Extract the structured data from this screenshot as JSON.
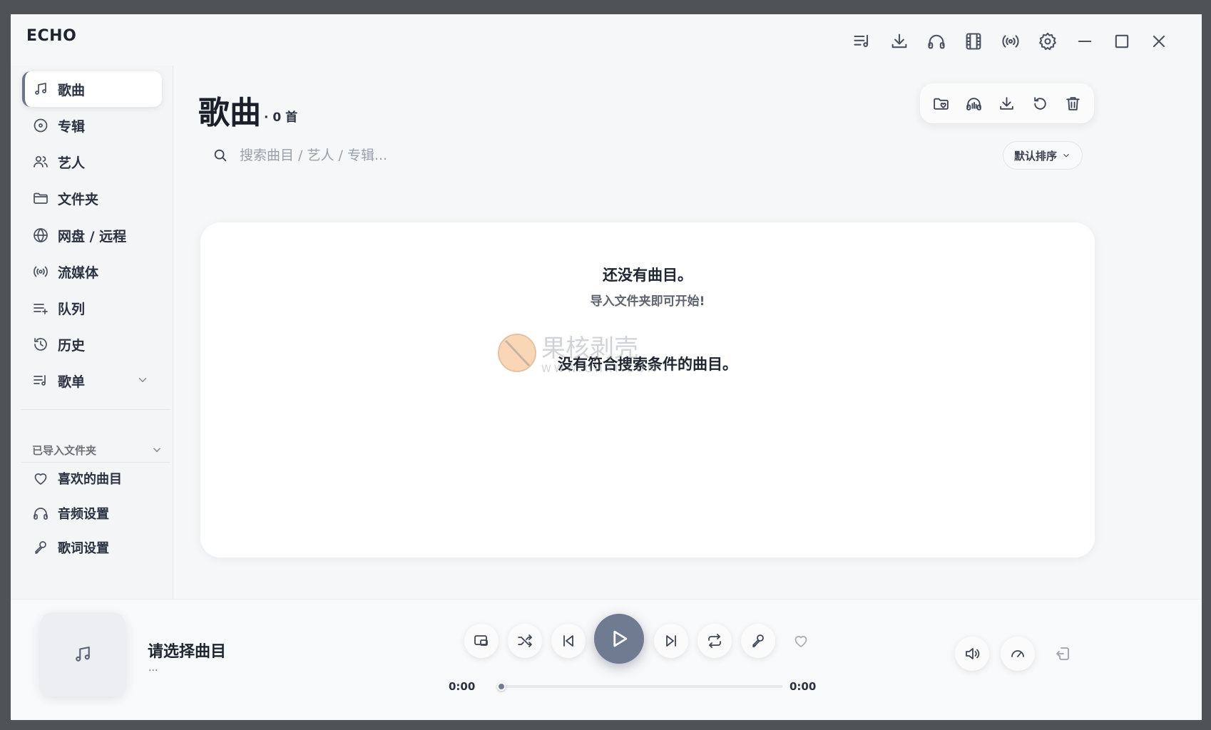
{
  "app": {
    "title": "ECHO"
  },
  "titlebar": {
    "icons": [
      "playlist-icon",
      "download-icon",
      "headphones-icon",
      "film-icon",
      "broadcast-icon",
      "gear-icon",
      "minimize-icon",
      "maximize-icon",
      "close-icon"
    ]
  },
  "sidebar": {
    "items": [
      {
        "label": "歌曲",
        "icon": "music-note-icon",
        "active": true
      },
      {
        "label": "专辑",
        "icon": "disc-icon"
      },
      {
        "label": "艺人",
        "icon": "users-icon"
      },
      {
        "label": "文件夹",
        "icon": "folder-icon"
      },
      {
        "label": "网盘 / 远程",
        "icon": "globe-icon"
      },
      {
        "label": "流媒体",
        "icon": "broadcast-icon"
      },
      {
        "label": "队列",
        "icon": "queue-icon"
      },
      {
        "label": "历史",
        "icon": "history-icon"
      },
      {
        "label": "歌单",
        "icon": "playlist-icon"
      }
    ],
    "section": {
      "label": "已导入文件夹"
    },
    "sub_items": [
      {
        "label": "喜欢的曲目",
        "icon": "heart-icon"
      },
      {
        "label": "音频设置",
        "icon": "headphones-icon"
      },
      {
        "label": "歌词设置",
        "icon": "microphone-icon"
      }
    ]
  },
  "main": {
    "title": "歌曲",
    "count": "· 0 首",
    "search": {
      "placeholder": "搜索曲目 / 艺人 / 专辑...",
      "value": ""
    },
    "sort": {
      "label": "默认排序"
    },
    "actions": [
      "folder-heart-icon",
      "headphones-scan-icon",
      "download-icon",
      "refresh-icon",
      "trash-icon"
    ],
    "empty": {
      "title": "还没有曲目。",
      "subtitle": "导入文件夹即可开始!",
      "no_match": "没有符合搜索条件的曲目。"
    }
  },
  "watermark": {
    "text": "果核剥壳",
    "url_text": "WWW.GHXI.COM"
  },
  "player": {
    "track_title": "请选择曲目",
    "track_artist": "...",
    "time_current": "0:00",
    "time_total": "0:00",
    "progress": 0,
    "accent": "#6f7b91"
  }
}
